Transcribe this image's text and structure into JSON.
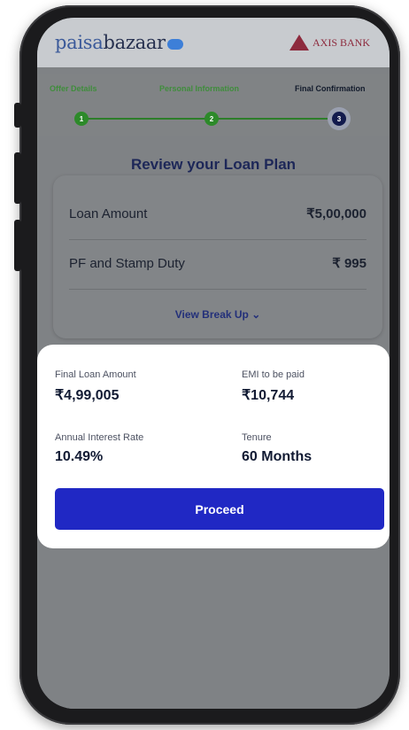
{
  "header": {
    "logo_text_a": "paisa",
    "logo_text_b": "bazaar",
    "bank_name": "AXIS BANK"
  },
  "steps": [
    {
      "label": "Offer Details",
      "number": "1",
      "state": "done"
    },
    {
      "label": "Personal Information",
      "number": "2",
      "state": "done"
    },
    {
      "label": "Final Confirmation",
      "number": "3",
      "state": "active"
    }
  ],
  "review": {
    "title": "Review your Loan Plan",
    "rows": [
      {
        "label": "Loan Amount",
        "value": "₹5,00,000"
      },
      {
        "label": "PF and Stamp Duty",
        "value": "₹ 995"
      }
    ],
    "breakup_label": "View Break Up"
  },
  "summary": {
    "final_loan_label": "Final Loan Amount",
    "final_loan_value": "₹4,99,005",
    "emi_label": "EMI to be paid",
    "emi_value": "₹10,744",
    "rate_label": "Annual Interest Rate",
    "rate_value": "10.49%",
    "tenure_label": "Tenure",
    "tenure_value": "60 Months",
    "proceed_label": "Proceed"
  },
  "colors": {
    "accent": "#2028c4",
    "brand": "#3b5a9a",
    "success": "#2d8a2a",
    "bank": "#8d2a3d"
  }
}
